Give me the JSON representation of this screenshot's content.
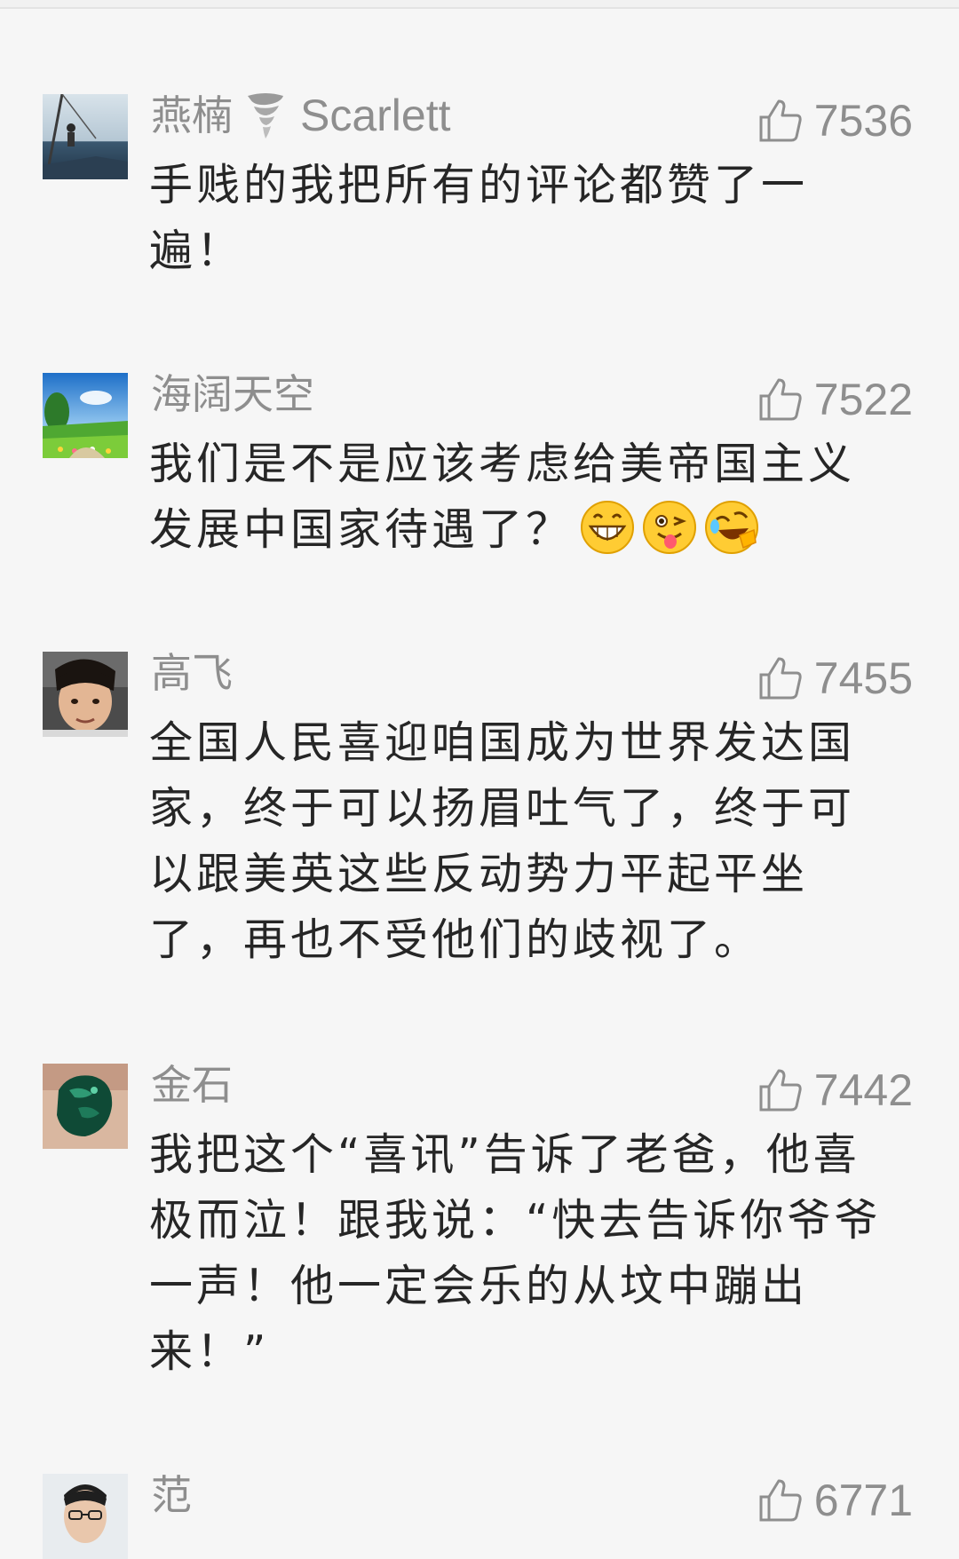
{
  "comments": [
    {
      "username": "燕楠",
      "username_suffix": "Scarlett",
      "likes": "7536",
      "text": "手贱的我把所有的评论都赞了一遍！",
      "avatar": "ship-deck-photo"
    },
    {
      "username": "海阔天空",
      "likes": "7522",
      "text": "我们是不是应该考虑给美帝国主义发展中国家待遇了？",
      "emojis": [
        "grinning-face-icon",
        "winking-tongue-face-icon",
        "rolling-laughing-face-icon"
      ],
      "avatar": "green-field-photo"
    },
    {
      "username": "高飞",
      "likes": "7455",
      "text": "全国人民喜迎咱国成为世界发达国家，终于可以扬眉吐气了，终于可以跟美英这些反动势力平起平坐了，再也不受他们的歧视了。",
      "avatar": "portrait-photo"
    },
    {
      "username": "金石",
      "likes": "7442",
      "text": "我把这个“喜讯”告诉了老爸，他喜极而泣！跟我说：“快去告诉你爷爷一声！他一定会乐的从坟中蹦出来！”",
      "avatar": "green-stone-photo"
    },
    {
      "username": "范",
      "likes": "6771",
      "text": "",
      "avatar": "portrait-glasses-photo"
    }
  ],
  "colors": {
    "background": "#f6f6f6",
    "username": "#8e8e8e",
    "body_text": "#262626"
  }
}
